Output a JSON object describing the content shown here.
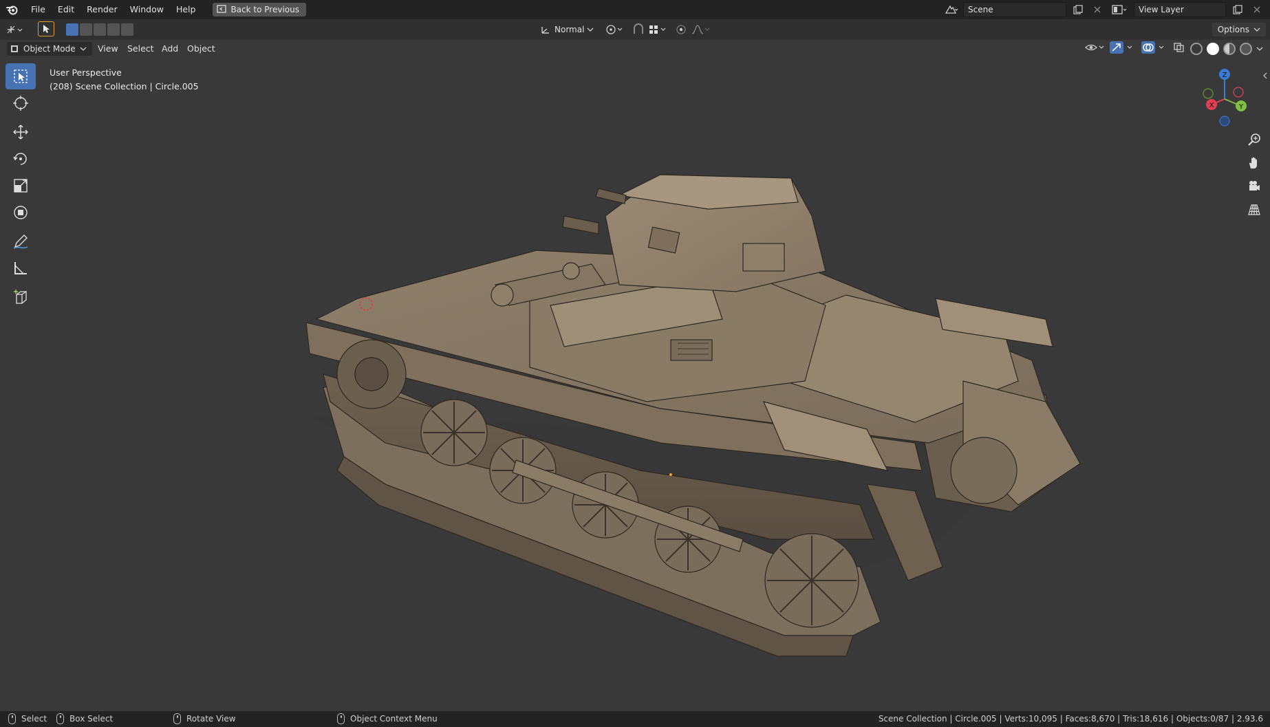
{
  "app": {
    "menu": [
      "File",
      "Edit",
      "Render",
      "Window",
      "Help"
    ],
    "back_button": "Back to Previous",
    "scene_name": "Scene",
    "view_layer": "View Layer"
  },
  "tool_header": {
    "orientation": "Normal",
    "options": "Options"
  },
  "viewport_header": {
    "mode": "Object Mode",
    "menus": [
      "View",
      "Select",
      "Add",
      "Object"
    ]
  },
  "viewport": {
    "perspective": "User Perspective",
    "collection_info": "(208) Scene Collection | Circle.005"
  },
  "gizmo": {
    "axes": {
      "x": "X",
      "y": "Y",
      "z": "Z"
    },
    "colors": {
      "x": "#e04050",
      "y": "#80c040",
      "z": "#3a7bd5"
    }
  },
  "toolbar": {
    "tools": [
      "select-box",
      "cursor",
      "move",
      "rotate",
      "scale",
      "transform",
      "annotate",
      "measure",
      "add-cube"
    ]
  },
  "statusbar": {
    "select": "Select",
    "box_select": "Box Select",
    "rotate_view": "Rotate View",
    "context_menu": "Object Context Menu",
    "stats": "Scene Collection | Circle.005 | Verts:10,095 | Faces:8,670 | Tris:18,616 | Objects:0/87 | 2.93.6"
  },
  "colors": {
    "accent": "#4772b3",
    "viewport_bg": "#393939",
    "model": "#8a7a66"
  }
}
